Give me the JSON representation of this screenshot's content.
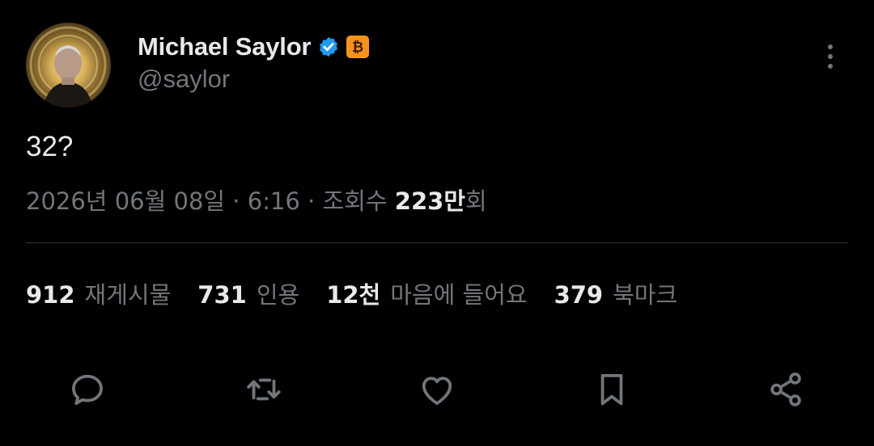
{
  "author": {
    "display_name": "Michael Saylor",
    "handle": "@saylor",
    "verified_icon": "verified-badge-icon",
    "affiliation_icon": "bitcoin-icon",
    "accent_color": "#1d9bf0",
    "affiliation_color": "#f7931a"
  },
  "tweet": {
    "text": "32?",
    "date": "2026년 06월 08일",
    "sep1": " · ",
    "time": "6:16",
    "sep2": " · ",
    "views_label": "조회수 ",
    "views_count": "223만",
    "views_suffix": "회"
  },
  "stats": [
    {
      "count": "912",
      "label": "재게시물"
    },
    {
      "count": "731",
      "label": "인용"
    },
    {
      "count": "12천",
      "label": "마음에 들어요"
    },
    {
      "count": "379",
      "label": "북마크"
    }
  ],
  "actions": [
    "reply-icon",
    "repost-icon",
    "like-icon",
    "bookmark-icon",
    "share-icon"
  ],
  "colors": {
    "background": "#000000",
    "primary_text": "#e7e9ea",
    "secondary_text": "#71767b",
    "divider": "#2f3336"
  }
}
